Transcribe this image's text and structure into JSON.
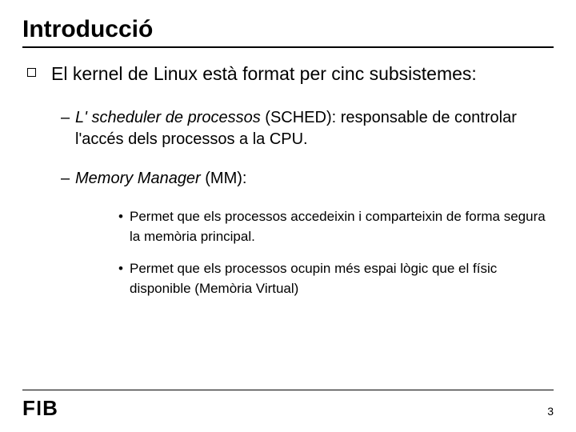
{
  "title": "Introducció",
  "lvl1": {
    "text": "El kernel de Linux està format per cinc subsistemes:"
  },
  "lvl2": {
    "item1": {
      "dash": "–",
      "italic": "L' scheduler de processos",
      "rest": " (SCHED): responsable de controlar l'accés dels processos a la CPU."
    },
    "item2": {
      "dash": "–",
      "italic": "Memory Manager",
      "rest": " (MM):"
    }
  },
  "lvl3": {
    "dot": "•",
    "item1": "Permet que els processos accedeixin i comparteixin de forma segura  la memòria principal.",
    "item2": "Permet que els processos ocupin més espai lògic que el físic disponible (Memòria Virtual)"
  },
  "footer": {
    "logo": "FIB",
    "page": "3"
  }
}
